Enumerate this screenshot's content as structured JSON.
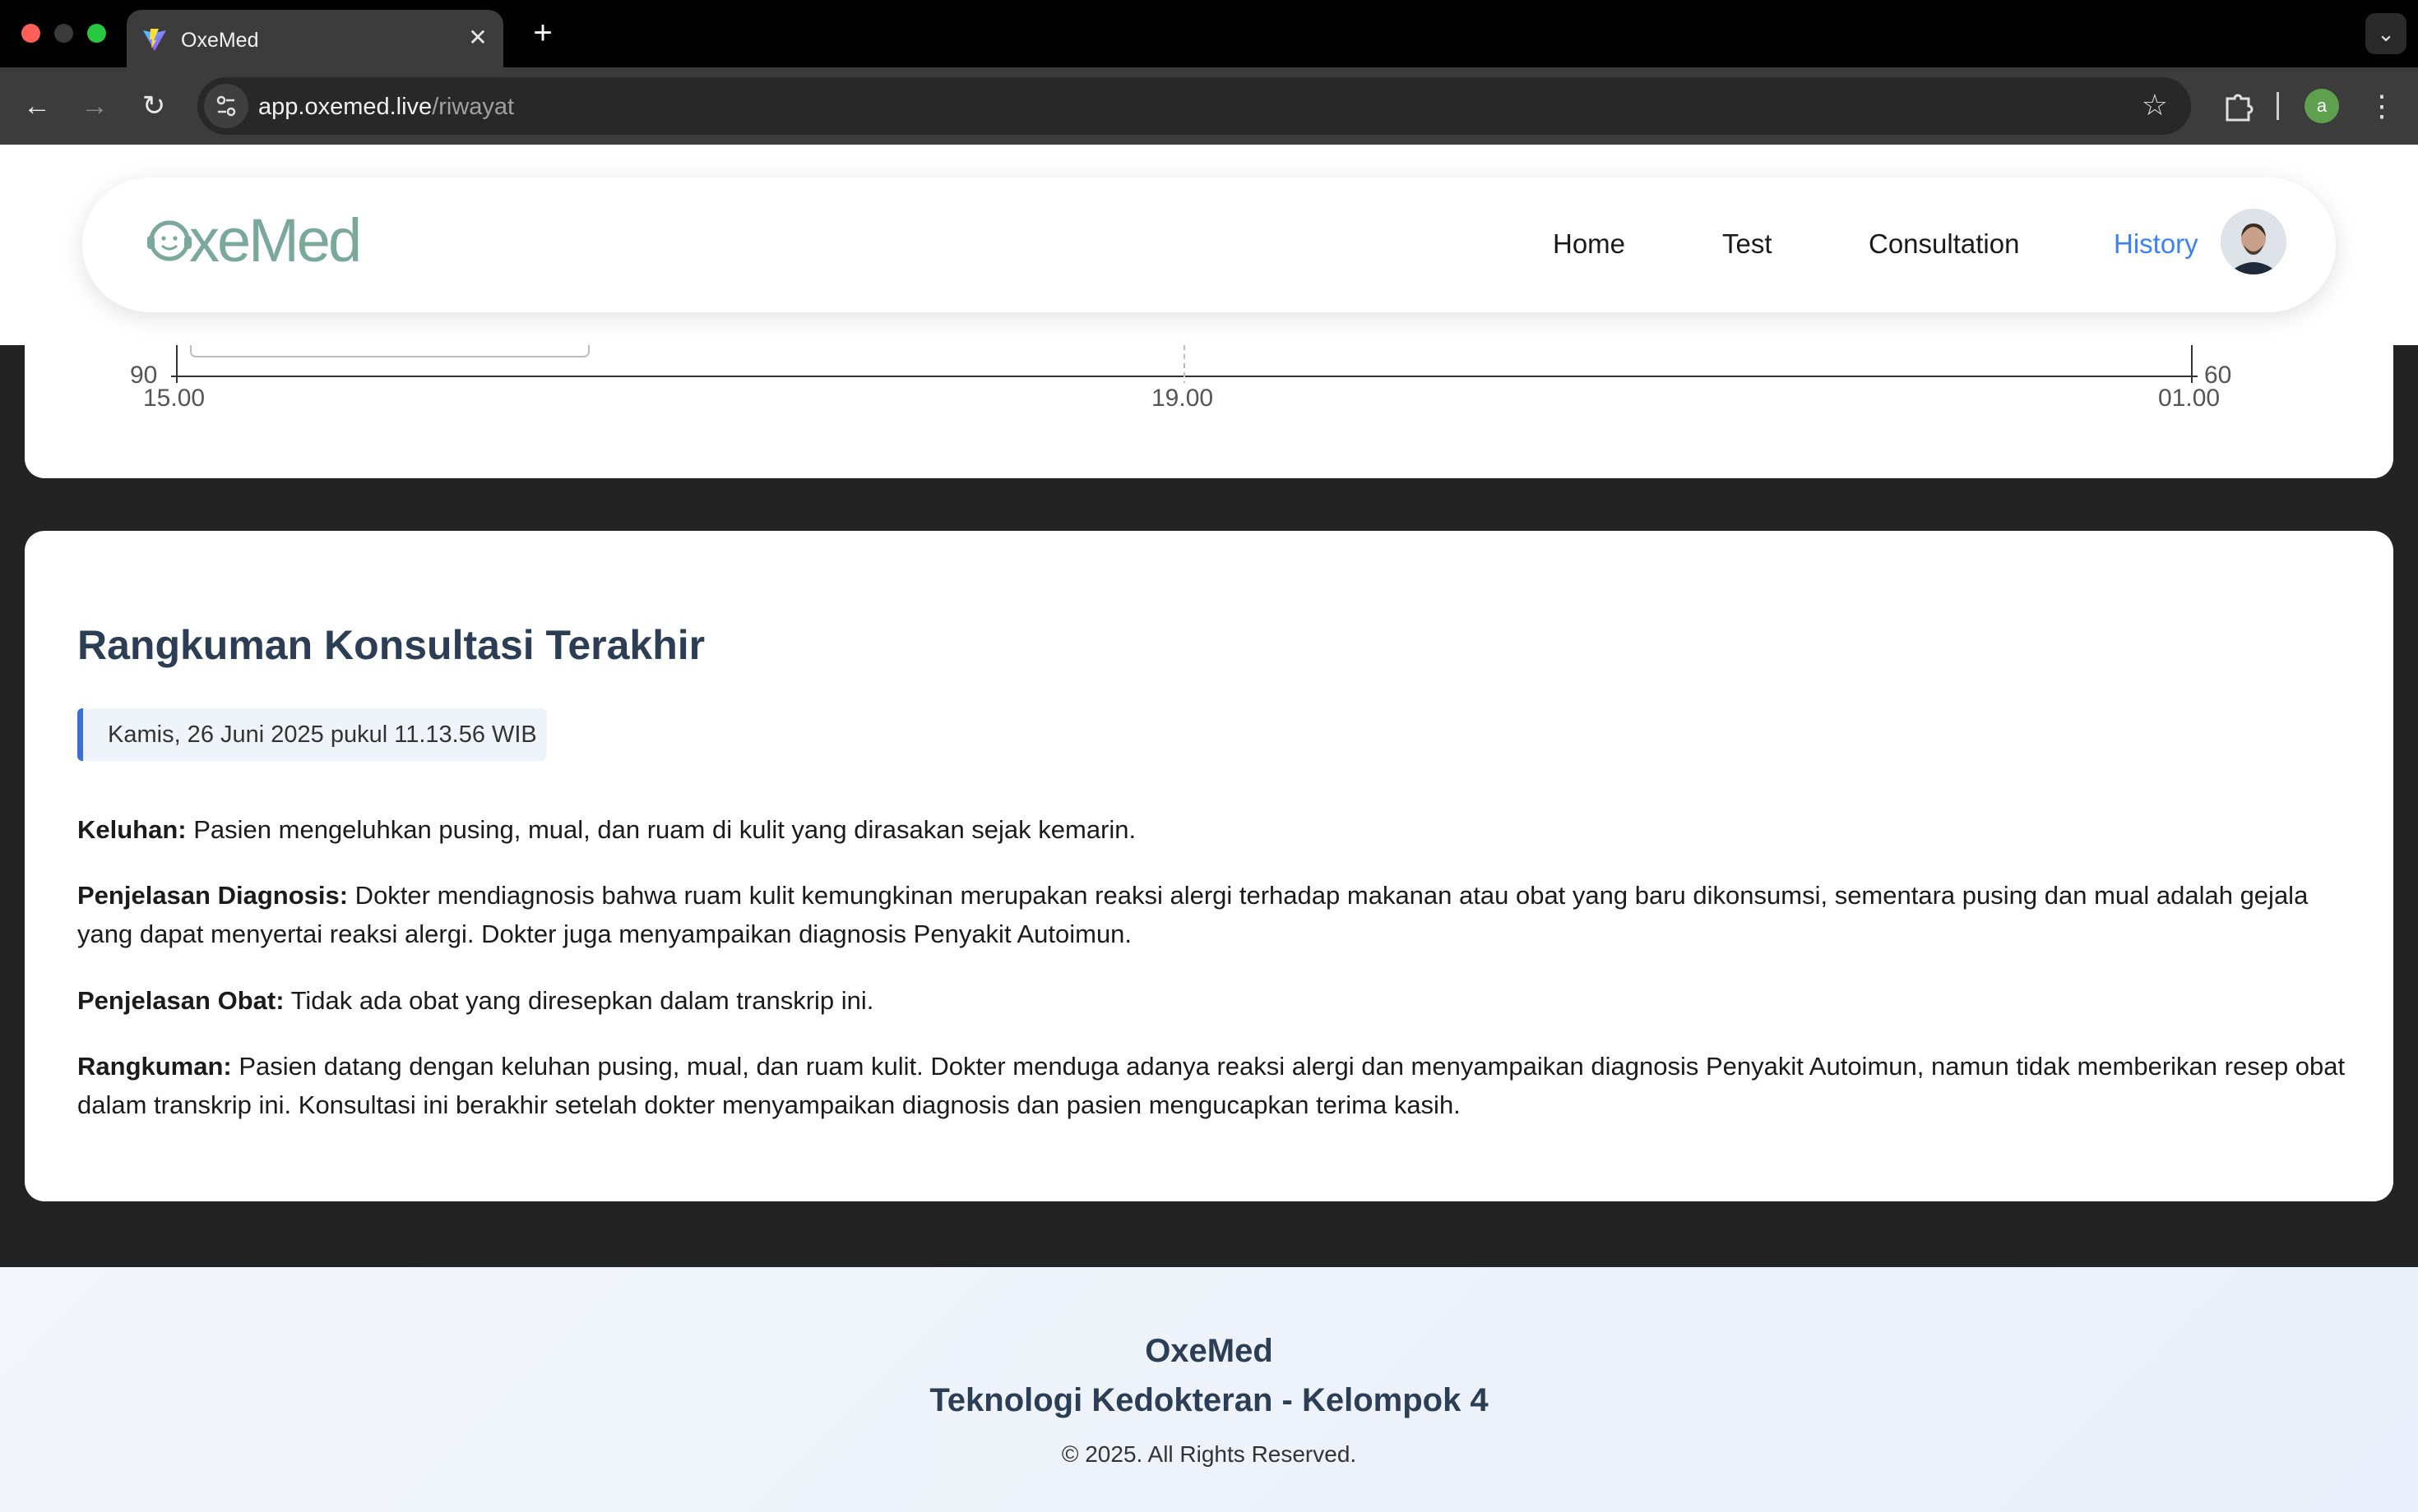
{
  "browser": {
    "tab_title": "OxeMed",
    "tab_close": "✕",
    "new_tab": "+",
    "url_host": "app.oxemed.live",
    "url_path": "/riwayat",
    "profile_initial": "a"
  },
  "header": {
    "logo_text": "xeMed",
    "nav": {
      "home": "Home",
      "test": "Test",
      "consultation": "Consultation",
      "history": "History"
    },
    "active_nav": "History",
    "accent_color": "#3b82f6"
  },
  "chart": {
    "left_axis_label": "90",
    "right_axis_label": "60",
    "x_ticks": [
      "15.00",
      "19.00",
      "01.00"
    ]
  },
  "summary": {
    "title": "Rangkuman Konsultasi Terakhir",
    "date": "Kamis, 26 Juni 2025 pukul 11.13.56 WIB",
    "keluhan_label": "Keluhan:",
    "keluhan_text": " Pasien mengeluhkan pusing, mual, dan ruam di kulit yang dirasakan sejak kemarin.",
    "diagnosis_label": "Penjelasan Diagnosis:",
    "diagnosis_text": " Dokter mendiagnosis bahwa ruam kulit kemungkinan merupakan reaksi alergi terhadap makanan atau obat yang baru dikonsumsi, sementara pusing dan mual adalah gejala yang dapat menyertai reaksi alergi. Dokter juga menyampaikan diagnosis Penyakit Autoimun.",
    "obat_label": "Penjelasan Obat:",
    "obat_text": " Tidak ada obat yang diresepkan dalam transkrip ini.",
    "rangkuman_label": "Rangkuman:",
    "rangkuman_text": " Pasien datang dengan keluhan pusing, mual, dan ruam kulit. Dokter menduga adanya reaksi alergi dan menyampaikan diagnosis Penyakit Autoimun, namun tidak memberikan resep obat dalam transkrip ini. Konsultasi ini berakhir setelah dokter menyampaikan diagnosis dan pasien mengucapkan terima kasih."
  },
  "footer": {
    "brand": "OxeMed",
    "subtitle": "Teknologi Kedokteran - Kelompok 4",
    "copyright": "© 2025. All Rights Reserved."
  }
}
